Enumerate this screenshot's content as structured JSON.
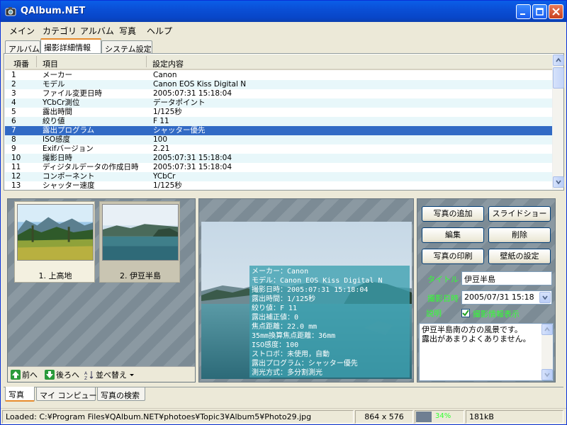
{
  "window": {
    "title": "QAlbum.NET"
  },
  "menu": [
    "メイン",
    "カテゴリ",
    "アルバム",
    "写真",
    "ヘルプ"
  ],
  "top_tabs": [
    "アルバム",
    "撮影詳細情報",
    "システム設定"
  ],
  "list": {
    "headers": [
      "項番",
      "項目",
      "設定内容"
    ],
    "rows": [
      [
        "1",
        "メーカー",
        "Canon"
      ],
      [
        "2",
        "モデル",
        "Canon EOS Kiss Digital N"
      ],
      [
        "3",
        "ファイル変更日時",
        "2005:07:31 15:18:04"
      ],
      [
        "4",
        "YCbCr測位",
        "データポイント"
      ],
      [
        "5",
        "露出時間",
        "1/125秒"
      ],
      [
        "6",
        "絞り値",
        "F 11"
      ],
      [
        "7",
        "露出プログラム",
        "シャッター優先"
      ],
      [
        "8",
        "ISO感度",
        "100"
      ],
      [
        "9",
        "Exifバージョン",
        "2.21"
      ],
      [
        "10",
        "撮影日時",
        "2005:07:31 15:18:04"
      ],
      [
        "11",
        "ディジタルデータの作成日時",
        "2005:07:31 15:18:04"
      ],
      [
        "12",
        "コンポーネント",
        "YCbCr"
      ],
      [
        "13",
        "シャッター速度",
        "1/125秒"
      ]
    ],
    "selected_row": "7"
  },
  "thumbnails": [
    "1. 上高地",
    "2. 伊豆半島"
  ],
  "nav": {
    "prev": "前へ",
    "next": "後ろへ",
    "sort": "並べ替え"
  },
  "exif_overlay": [
    "メーカー：Canon",
    "モデル：Canon EOS Kiss Digital N",
    "撮影日時：2005:07:31 15:18:04",
    "露出時間：1/125秒",
    "絞り値：F 11",
    "露出補正値：0",
    "焦点距離：22.0 mm",
    "35mm換算焦点距離：36mm",
    "ISO感度：100",
    "ストロボ：未使用，自動",
    "露出プログラム：シャッター優先",
    "測光方式：多分割測光"
  ],
  "buttons": {
    "add_photo": "写真の追加",
    "slideshow": "スライドショー",
    "edit": "編集",
    "delete": "削除",
    "print": "写真の印刷",
    "wallpaper": "壁紙の設定"
  },
  "details": {
    "title_label": "タイトル",
    "title_value": "伊豆半島",
    "date_label": "撮影日時",
    "date_value": "2005/07/31 15:18",
    "desc_label": "説明",
    "exif_check_label": "撮影情報表示",
    "description": "伊豆半島南の方の風景です。\n露出があまりよくありません。"
  },
  "bottom_tabs": [
    "写真",
    "マイ コンピュータ",
    "写真の検索"
  ],
  "status": {
    "path": "Loaded: C:¥Program Files¥QAlbum.NET¥photoes¥Topic3¥Album5¥Photo29.jpg",
    "dimensions": "864 x 576",
    "progress_pct": 34,
    "progress_label": "34%",
    "size": "181kB"
  },
  "colors": {
    "selection": "#316ac5",
    "alt_row": "#e8f7fa",
    "label_green": "#33ff33"
  }
}
